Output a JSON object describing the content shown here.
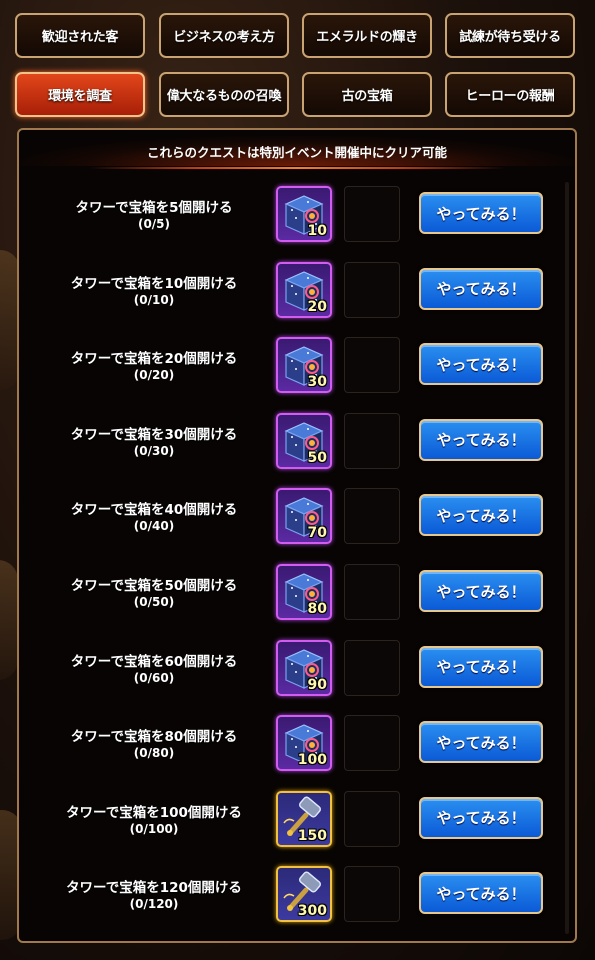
{
  "tabs": [
    {
      "label": "歓迎された客",
      "active": false
    },
    {
      "label": "ビジネスの考え方",
      "active": false
    },
    {
      "label": "エメラルドの輝き",
      "active": false
    },
    {
      "label": "試練が待ち受ける",
      "active": false
    },
    {
      "label": "環境を調査",
      "active": true
    },
    {
      "label": "偉大なるものの召喚",
      "active": false
    },
    {
      "label": "古の宝箱",
      "active": false
    },
    {
      "label": "ヒーローの報酬",
      "active": false
    }
  ],
  "panel": {
    "banner": "これらのクエストは特別イベント開催中にクリア可能"
  },
  "quests": [
    {
      "title": "タワーで宝箱を5個開ける",
      "progress": "(0/5)",
      "reward_count": "10",
      "reward_icon": "purple-chest-icon",
      "button": "やってみる！"
    },
    {
      "title": "タワーで宝箱を10個開ける",
      "progress": "(0/10)",
      "reward_count": "20",
      "reward_icon": "purple-chest-icon",
      "button": "やってみる！"
    },
    {
      "title": "タワーで宝箱を20個開ける",
      "progress": "(0/20)",
      "reward_count": "30",
      "reward_icon": "purple-chest-icon",
      "button": "やってみる！"
    },
    {
      "title": "タワーで宝箱を30個開ける",
      "progress": "(0/30)",
      "reward_count": "50",
      "reward_icon": "purple-chest-icon",
      "button": "やってみる！"
    },
    {
      "title": "タワーで宝箱を40個開ける",
      "progress": "(0/40)",
      "reward_count": "70",
      "reward_icon": "purple-chest-icon",
      "button": "やってみる！"
    },
    {
      "title": "タワーで宝箱を50個開ける",
      "progress": "(0/50)",
      "reward_count": "80",
      "reward_icon": "purple-chest-icon",
      "button": "やってみる！"
    },
    {
      "title": "タワーで宝箱を60個開ける",
      "progress": "(0/60)",
      "reward_count": "90",
      "reward_icon": "purple-chest-icon",
      "button": "やってみる！"
    },
    {
      "title": "タワーで宝箱を80個開ける",
      "progress": "(0/80)",
      "reward_count": "100",
      "reward_icon": "purple-chest-icon",
      "button": "やってみる！"
    },
    {
      "title": "タワーで宝箱を100個開ける",
      "progress": "(0/100)",
      "reward_count": "150",
      "reward_icon": "gold-hammer-icon",
      "button": "やってみる！"
    },
    {
      "title": "タワーで宝箱を120個開ける",
      "progress": "(0/120)",
      "reward_count": "300",
      "reward_icon": "gold-hammer-icon",
      "button": "やってみる！"
    }
  ],
  "colors": {
    "active_tab": "#d83a14",
    "button_blue": "#1a72e6",
    "tab_border": "#c9a371",
    "purple_frame": "#d25cf0",
    "gold_frame": "#f2c23e"
  }
}
